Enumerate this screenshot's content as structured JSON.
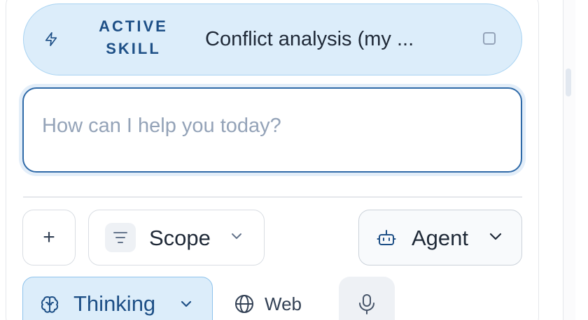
{
  "active_skill": {
    "tag_line1": "ACTIVE",
    "tag_line2": "SKILL",
    "title": "Conflict analysis (my ...",
    "icon": "bolt-icon",
    "close_icon": "square-close-icon"
  },
  "prompt": {
    "placeholder": "How can I help you today?",
    "value": ""
  },
  "toolbar": {
    "add_label": "+",
    "scope_label": "Scope",
    "agent_label": "Agent",
    "thinking_label": "Thinking",
    "web_label": "Web",
    "icons": {
      "scope": "filter-icon",
      "agent": "robot-icon",
      "thinking": "brain-icon",
      "web": "globe-icon",
      "mic": "microphone-icon"
    }
  },
  "colors": {
    "accent": "#2f6aa8",
    "skill_bg": "#dcedfa",
    "skill_text": "#1d4f86"
  }
}
